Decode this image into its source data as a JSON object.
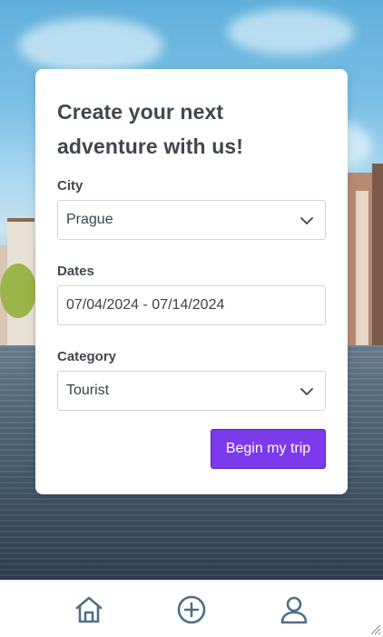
{
  "form": {
    "title": "Create your next adventure with us!",
    "city": {
      "label": "City",
      "value": "Prague"
    },
    "dates": {
      "label": "Dates",
      "value": "07/04/2024 - 07/14/2024"
    },
    "category": {
      "label": "Category",
      "value": "Tourist"
    },
    "submit_label": "Begin my trip"
  },
  "nav": {
    "items": [
      {
        "icon": "home-icon"
      },
      {
        "icon": "add-circle-icon"
      },
      {
        "icon": "user-icon"
      }
    ]
  },
  "colors": {
    "accent": "#7c3aed",
    "nav_icon": "#4f6f85",
    "text": "#40474f"
  }
}
